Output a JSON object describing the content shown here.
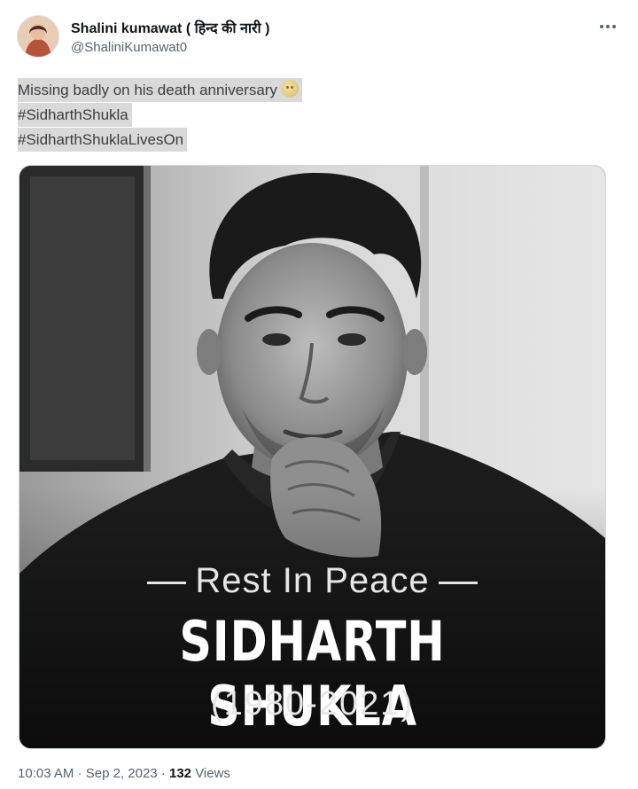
{
  "author": {
    "name": "Shalini kumawat ( हिन्द की नारी )",
    "handle": "@ShaliniKumawat0"
  },
  "more_icon": "more-horizontal-icon",
  "tweet": {
    "lines": [
      "Missing badly on his death anniversary",
      "#SidharthShukla",
      "#SidharthShuklaLivesOn"
    ],
    "emoji": "face-emoji"
  },
  "image": {
    "rest": "Rest In Peace",
    "name": "SIDHARTH SHUKLA",
    "years": "(1980-2021)"
  },
  "meta": {
    "time": "10:03 AM",
    "date": "Sep 2, 2023",
    "views_count": "132",
    "views_label": "Views"
  }
}
